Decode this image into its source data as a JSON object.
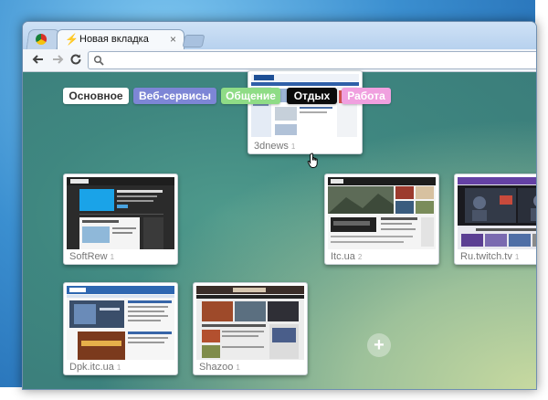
{
  "browser": {
    "active_tab": {
      "title": "Новая вкладка",
      "favicon": "lightning-icon",
      "close": "×"
    },
    "inactive_tab": {
      "favicon": "chrome-icon"
    },
    "toolbar": {
      "back": "back-arrow-icon",
      "forward": "forward-arrow-icon",
      "reload": "reload-icon",
      "search": "search-icon"
    }
  },
  "categories": [
    {
      "label": "Основное",
      "color": "#ffffff"
    },
    {
      "label": "Веб-сервисы",
      "color": "#7d86d6"
    },
    {
      "label": "Общение",
      "color": "#8fdc86"
    },
    {
      "label": "Отдых",
      "color": "#0b0b0b"
    },
    {
      "label": "Работа",
      "color": "#f0a0df"
    }
  ],
  "thumbnails": [
    {
      "site": "3dnews",
      "num": "1"
    },
    {
      "site": "SoftRew",
      "num": "1"
    },
    {
      "site": "Itc.ua",
      "num": "2"
    },
    {
      "site": "Ru.twitch.tv",
      "num": "1"
    },
    {
      "site": "Dpk.itc.ua",
      "num": "1"
    },
    {
      "site": "Shazoo",
      "num": "1"
    }
  ],
  "add_button": "+"
}
